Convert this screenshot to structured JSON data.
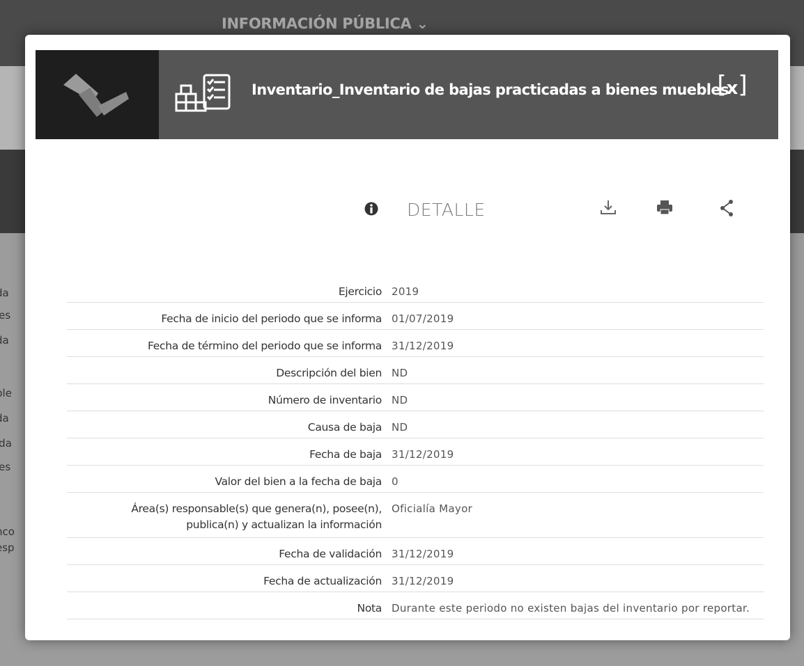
{
  "background": {
    "menu_label": "INFORMACIÓN PÚBLICA ⌄",
    "side_fragments": [
      "da",
      "les",
      "da",
      "ble",
      "da",
      "ida",
      "les",
      "nco",
      "esp"
    ]
  },
  "modal": {
    "title": "Inventario_Inventario de bajas practicadas a bienes muebles",
    "close_label": "x",
    "section_label": "DETALLE",
    "icons": [
      "logo",
      "document-grid-icon",
      "info-icon",
      "download-icon",
      "print-icon",
      "share-icon",
      "close-icon"
    ]
  },
  "details": [
    {
      "label": "Ejercicio",
      "value": "2019"
    },
    {
      "label": "Fecha de inicio del periodo que se informa",
      "value": "01/07/2019"
    },
    {
      "label": "Fecha de término del periodo que se informa",
      "value": "31/12/2019"
    },
    {
      "label": "Descripción del bien",
      "value": "ND"
    },
    {
      "label": "Número de inventario",
      "value": "ND"
    },
    {
      "label": "Causa de baja",
      "value": "ND"
    },
    {
      "label": "Fecha de baja",
      "value": "31/12/2019"
    },
    {
      "label": "Valor del bien a la fecha de baja",
      "value": "0"
    },
    {
      "label": "Área(s) responsable(s) que genera(n), posee(n), publica(n) y actualizan la información",
      "value": "Oficialía Mayor"
    },
    {
      "label": "Fecha de validación",
      "value": "31/12/2019"
    },
    {
      "label": "Fecha de actualización",
      "value": "31/12/2019"
    },
    {
      "label": "Nota",
      "value": "Durante este periodo no existen bajas del inventario por reportar."
    }
  ]
}
